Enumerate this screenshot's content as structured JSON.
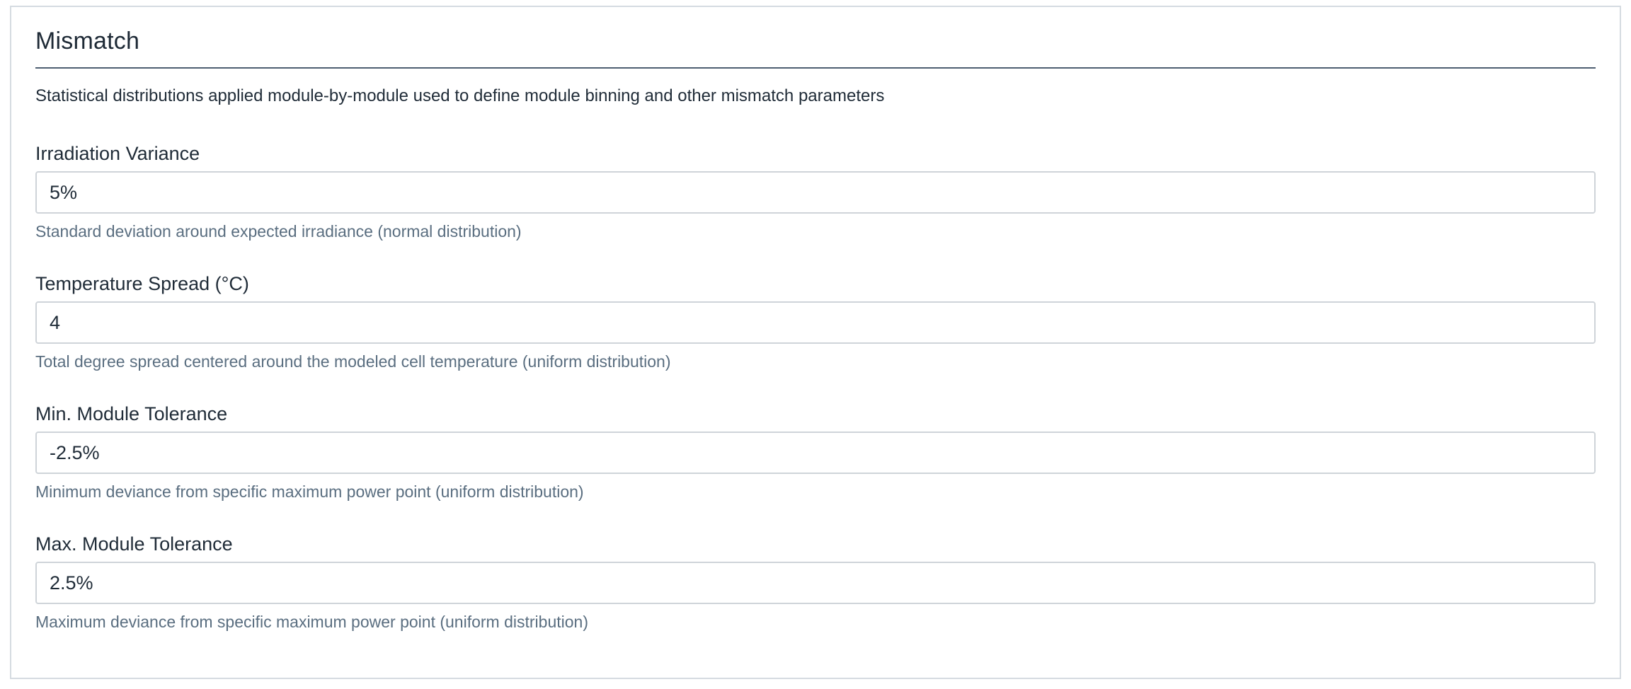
{
  "section": {
    "title": "Mismatch",
    "description": "Statistical distributions applied module-by-module used to define module binning and other mismatch parameters"
  },
  "fields": [
    {
      "label": "Irradiation Variance",
      "value": "5%",
      "help": "Standard deviation around expected irradiance (normal distribution)"
    },
    {
      "label": "Temperature Spread (°C)",
      "value": "4",
      "help": "Total degree spread centered around the modeled cell temperature (uniform distribution)"
    },
    {
      "label": "Min. Module Tolerance",
      "value": "-2.5%",
      "help": "Minimum deviance from specific maximum power point (uniform distribution)"
    },
    {
      "label": "Max. Module Tolerance",
      "value": "2.5%",
      "help": "Maximum deviance from specific maximum power point (uniform distribution)"
    }
  ],
  "colors": {
    "title_rule": "#4e5e71",
    "input_border": "#cfd4d9",
    "help_text": "#5a6e80",
    "panel_border": "#d5dbe1"
  }
}
